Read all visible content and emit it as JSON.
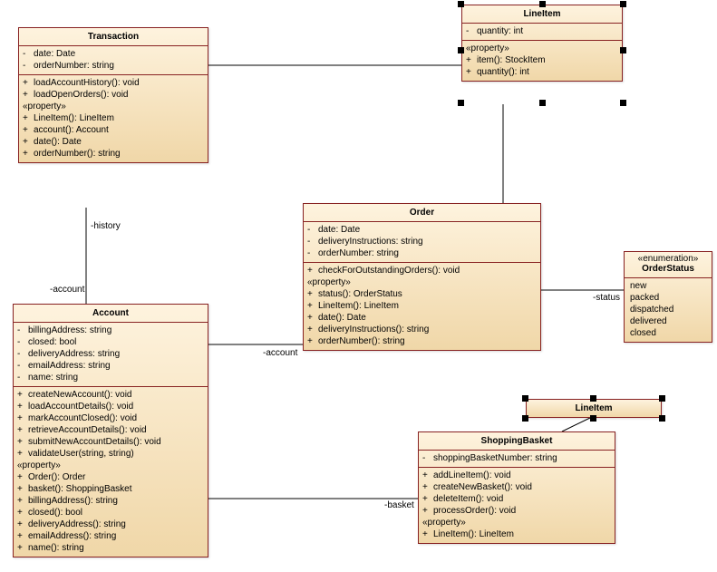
{
  "classes": {
    "transaction": {
      "name": "Transaction",
      "attrs": [
        {
          "vis": "-",
          "sig": "date: Date"
        },
        {
          "vis": "-",
          "sig": "orderNumber: string"
        }
      ],
      "ops": [
        {
          "vis": "+",
          "sig": "loadAccountHistory(): void"
        },
        {
          "vis": "+",
          "sig": "loadOpenOrders(): void"
        }
      ],
      "propLabel": "«property»",
      "props": [
        {
          "vis": "+",
          "sig": "LineItem(): LineItem"
        },
        {
          "vis": "+",
          "sig": "account(): Account"
        },
        {
          "vis": "+",
          "sig": "date(): Date"
        },
        {
          "vis": "+",
          "sig": "orderNumber(): string"
        }
      ]
    },
    "lineitemTop": {
      "name": "LineItem",
      "attrs": [
        {
          "vis": "-",
          "sig": "quantity: int"
        }
      ],
      "propLabel": "«property»",
      "props": [
        {
          "vis": "+",
          "sig": "item(): StockItem"
        },
        {
          "vis": "+",
          "sig": "quantity(): int"
        }
      ]
    },
    "order": {
      "name": "Order",
      "attrs": [
        {
          "vis": "-",
          "sig": "date: Date"
        },
        {
          "vis": "-",
          "sig": "deliveryInstructions: string"
        },
        {
          "vis": "-",
          "sig": "orderNumber: string"
        }
      ],
      "ops": [
        {
          "vis": "+",
          "sig": "checkForOutstandingOrders(): void"
        }
      ],
      "propLabel": "«property»",
      "props": [
        {
          "vis": "+",
          "sig": "status(): OrderStatus"
        },
        {
          "vis": "+",
          "sig": "LineItem(): LineItem"
        },
        {
          "vis": "+",
          "sig": "date(): Date"
        },
        {
          "vis": "+",
          "sig": "deliveryInstructions(): string"
        },
        {
          "vis": "+",
          "sig": "orderNumber(): string"
        }
      ]
    },
    "orderStatus": {
      "stereo": "«enumeration»",
      "name": "OrderStatus",
      "values": [
        "new",
        "packed",
        "dispatched",
        "delivered",
        "closed"
      ]
    },
    "account": {
      "name": "Account",
      "attrs": [
        {
          "vis": "-",
          "sig": "billingAddress: string"
        },
        {
          "vis": "-",
          "sig": "closed: bool"
        },
        {
          "vis": "-",
          "sig": "deliveryAddress: string"
        },
        {
          "vis": "-",
          "sig": "emailAddress: string"
        },
        {
          "vis": "-",
          "sig": "name: string"
        }
      ],
      "ops": [
        {
          "vis": "+",
          "sig": "createNewAccount(): void"
        },
        {
          "vis": "+",
          "sig": "loadAccountDetails(): void"
        },
        {
          "vis": "+",
          "sig": "markAccountClosed(): void"
        },
        {
          "vis": "+",
          "sig": "retrieveAccountDetails(): void"
        },
        {
          "vis": "+",
          "sig": "submitNewAccountDetails(): void"
        },
        {
          "vis": "+",
          "sig": "validateUser(string, string)"
        }
      ],
      "propLabel": "«property»",
      "props": [
        {
          "vis": "+",
          "sig": "Order(): Order"
        },
        {
          "vis": "+",
          "sig": "basket(): ShoppingBasket"
        },
        {
          "vis": "+",
          "sig": "billingAddress(): string"
        },
        {
          "vis": "+",
          "sig": "closed(): bool"
        },
        {
          "vis": "+",
          "sig": "deliveryAddress(): string"
        },
        {
          "vis": "+",
          "sig": "emailAddress(): string"
        },
        {
          "vis": "+",
          "sig": "name(): string"
        }
      ]
    },
    "lineitemMid": {
      "name": "LineItem"
    },
    "shoppingBasket": {
      "name": "ShoppingBasket",
      "attrs": [
        {
          "vis": "-",
          "sig": "shoppingBasketNumber: string"
        }
      ],
      "ops": [
        {
          "vis": "+",
          "sig": "addLineItem(): void"
        },
        {
          "vis": "+",
          "sig": "createNewBasket(): void"
        },
        {
          "vis": "+",
          "sig": "deleteItem(): void"
        },
        {
          "vis": "+",
          "sig": "processOrder(): void"
        }
      ],
      "propLabel": "«property»",
      "props": [
        {
          "vis": "+",
          "sig": "LineItem(): LineItem"
        }
      ]
    }
  },
  "labels": {
    "history": "-history",
    "accountTrans": "-account",
    "accountOrder": "-account",
    "basket": "-basket",
    "status": "-status"
  }
}
